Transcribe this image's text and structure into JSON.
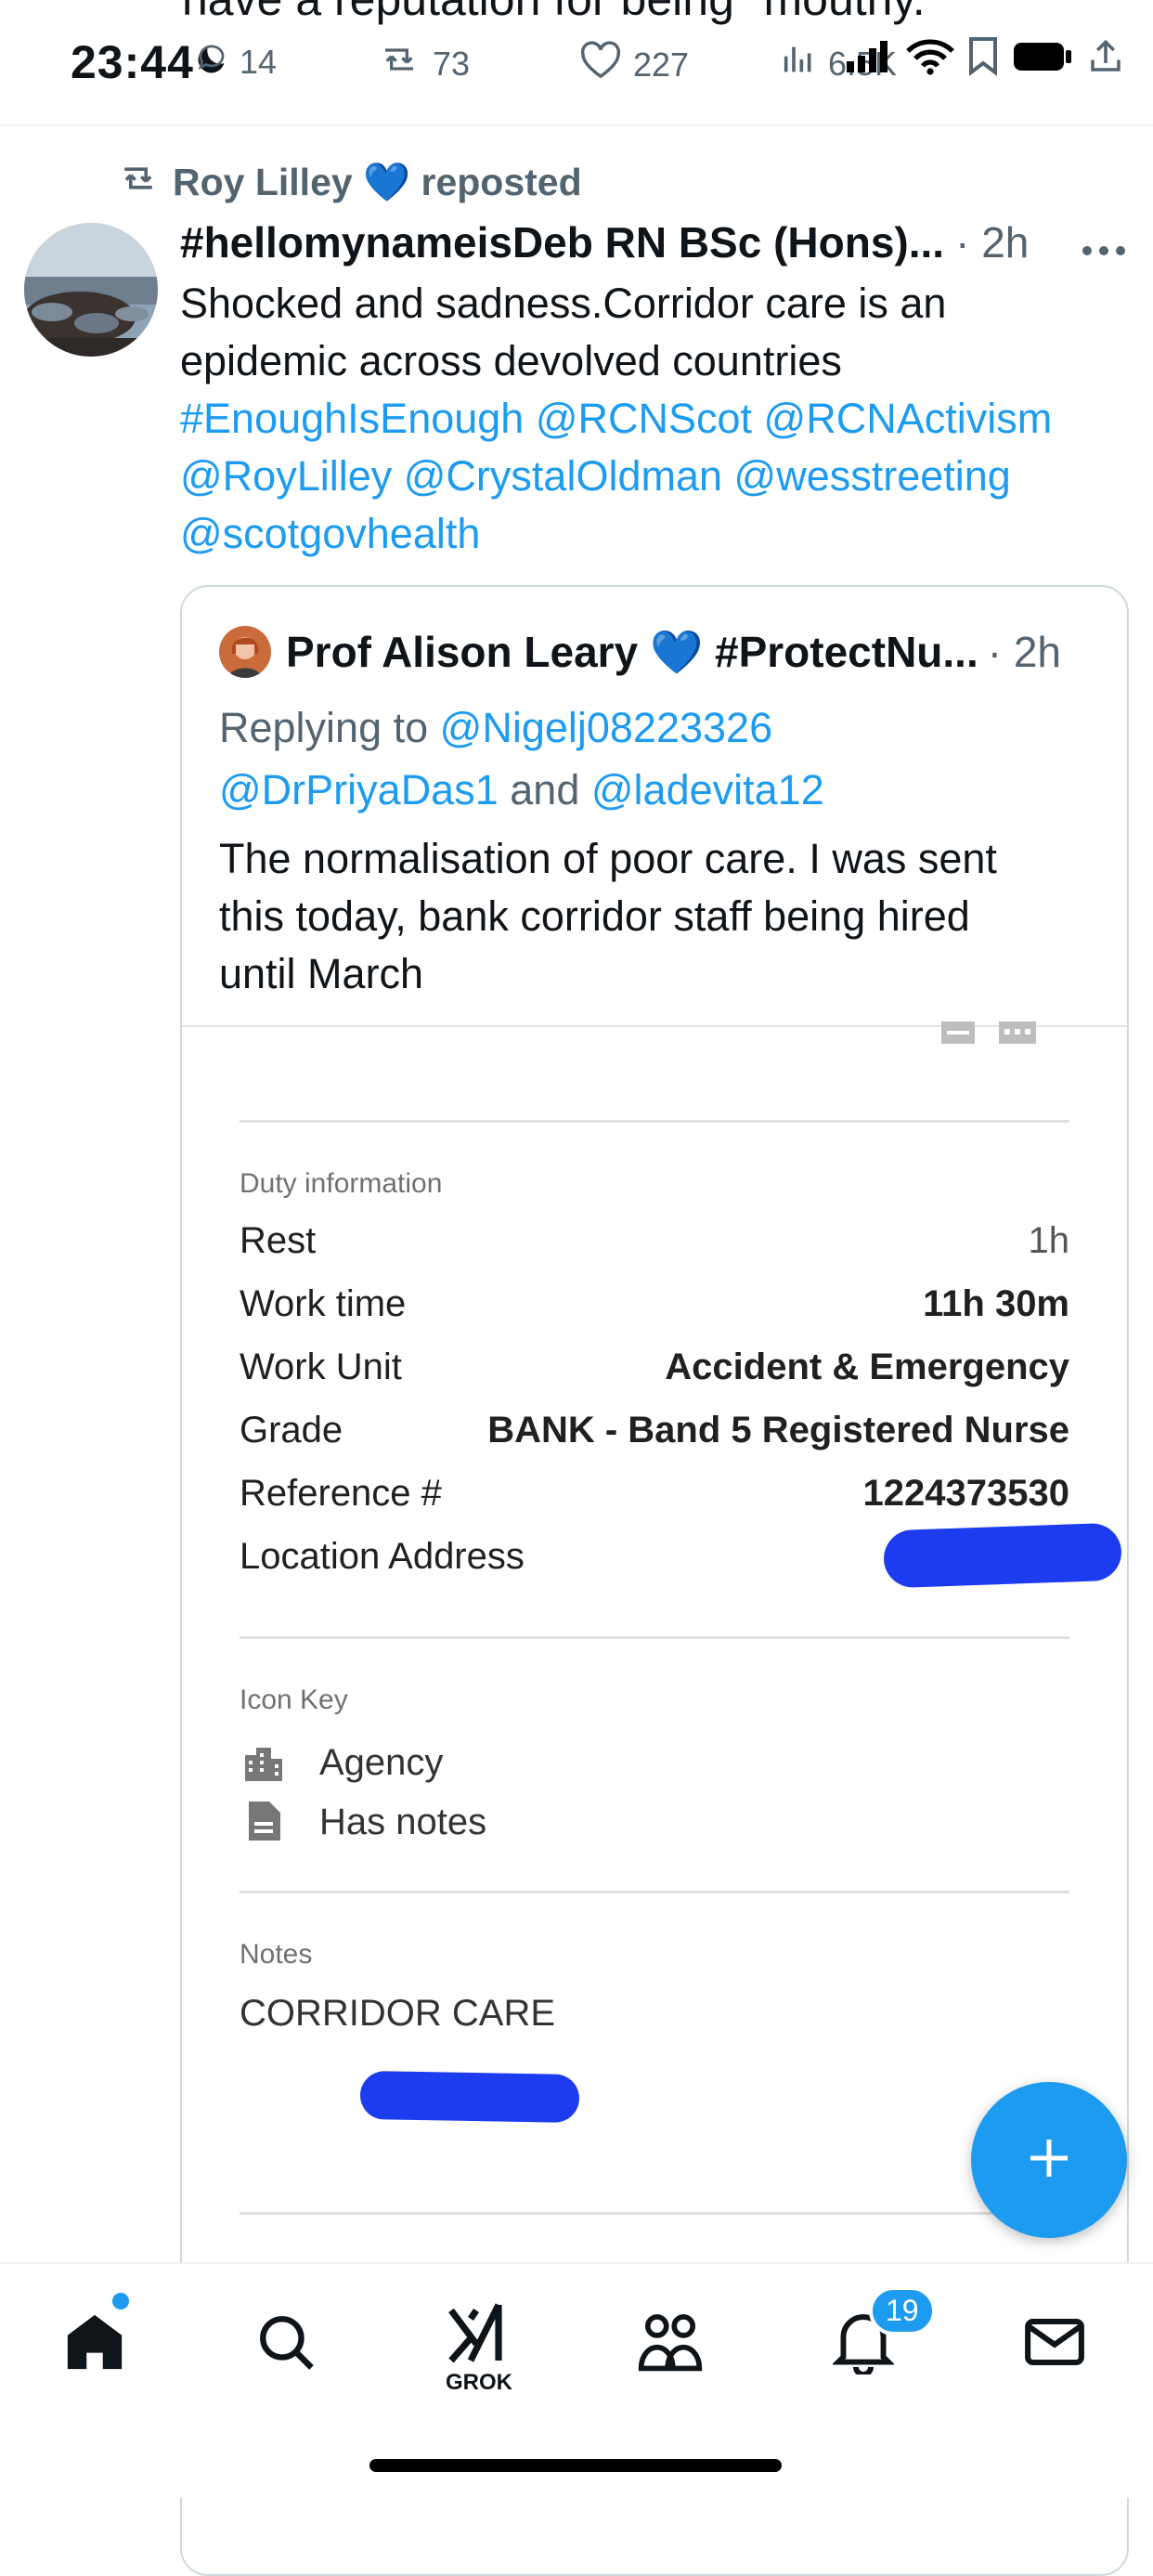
{
  "status_bar": {
    "time": "23:44",
    "previous_tweet_text": "have a reputation for being \"mouthy.\"",
    "replies": "14",
    "reposts": "73",
    "likes": "227",
    "views": "6.5K"
  },
  "tweet": {
    "repost_label": "Roy Lilley 💙 reposted",
    "author": "#hellomynameisDeb RN BSc (Hons)...",
    "time": "· 2h",
    "lines": [
      {
        "parts": [
          {
            "text": "Shocked and sadness.Corridor care is an",
            "link": false
          }
        ]
      },
      {
        "parts": [
          {
            "text": "epidemic across devolved countries",
            "link": false
          }
        ]
      },
      {
        "parts": [
          {
            "text": "#EnoughIsEnough @RCNScot @RCNActivism",
            "link": true
          }
        ]
      },
      {
        "parts": [
          {
            "text": "@RoyLilley @CrystalOldman @wesstreeting",
            "link": true
          }
        ]
      },
      {
        "parts": [
          {
            "text": "@scotgovhealth",
            "link": true
          }
        ]
      }
    ]
  },
  "quote": {
    "author": "Prof Alison Leary 💙 #ProtectNu...",
    "time": "· 2h",
    "replying_prefix": "Replying to",
    "replying_1": "@Nigelj08223326",
    "replying_2": "@DrPriyaDas1",
    "replying_and": "and",
    "replying_3": "@ladevita12",
    "text_lines": [
      "The normalisation of poor care.  I was sent",
      "this today, bank corridor staff being hired",
      "until March"
    ]
  },
  "screenshot": {
    "duty_title": "Duty information",
    "rows": [
      {
        "label": "Rest",
        "value": "1h",
        "bold": false
      },
      {
        "label": "Work time",
        "value": "11h 30m",
        "bold": true
      },
      {
        "label": "Work Unit",
        "value": "Accident & Emergency",
        "bold": true
      },
      {
        "label": "Grade",
        "value": "BANK - Band 5 Registered Nurse",
        "bold": true
      },
      {
        "label": "Reference #",
        "value": "1224373530",
        "bold": true
      },
      {
        "label": "Location Address",
        "value": "",
        "bold": false
      }
    ],
    "icon_key_title": "Icon Key",
    "icon_key_items": [
      "Agency",
      "Has notes"
    ],
    "notes_title": "Notes",
    "notes_text": "CORRIDOR CARE"
  },
  "nav": {
    "grok_label": "GROK",
    "notification_count": "19"
  },
  "colors": {
    "accent": "#1d9bf0",
    "text": "#0f1419",
    "muted": "#536471",
    "redaction": "#1d3cf0"
  }
}
